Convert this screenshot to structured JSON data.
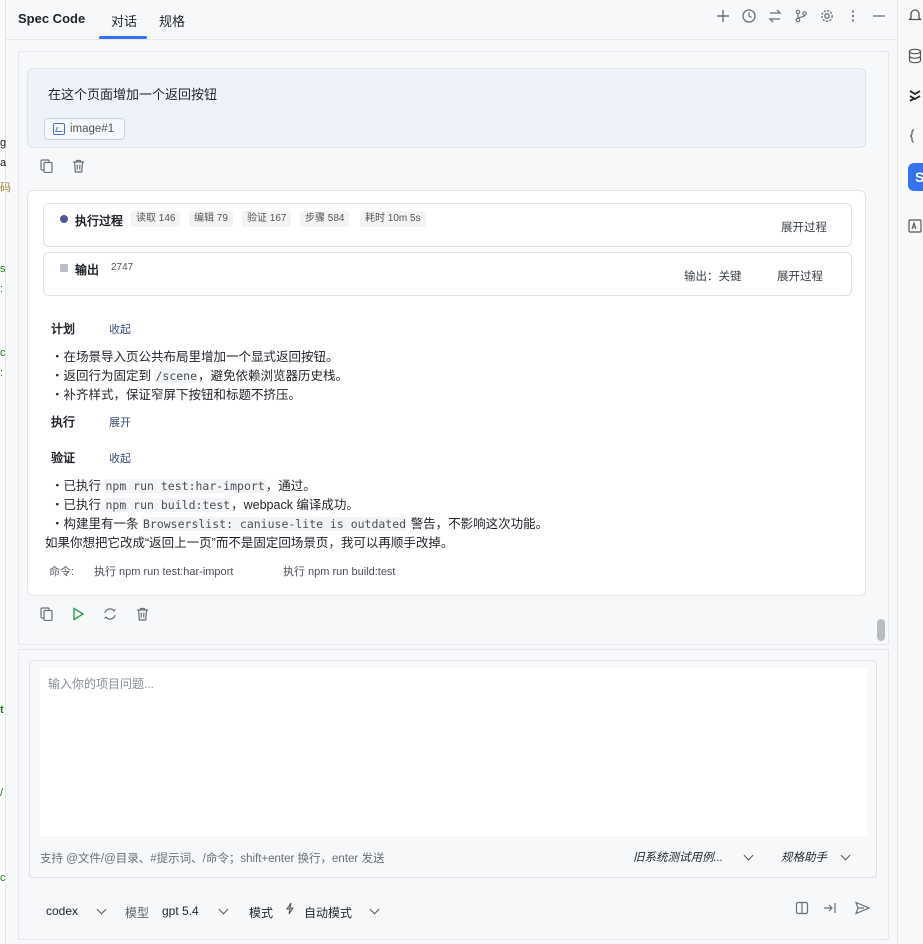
{
  "header": {
    "app_title": "Spec Code",
    "tabs": [
      {
        "label": "对话"
      },
      {
        "label": "规格"
      }
    ]
  },
  "left_strip_fragments": [
    "g",
    "a",
    "码",
    "s",
    ":",
    "c",
    ":",
    "t",
    "/",
    "c"
  ],
  "user_message": {
    "text": "在这个页面增加一个返回按钮",
    "attachment": "image#1"
  },
  "process_bar": {
    "title": "执行过程",
    "stats": [
      "读取 146",
      "编辑 79",
      "验证 167",
      "步骤 584",
      "耗时 10m 5s"
    ],
    "expand": "展开过程"
  },
  "output_bar": {
    "title": "输出",
    "count": "2747",
    "mode": "输出：关键",
    "expand": "展开过程"
  },
  "plan": {
    "title": "计划",
    "toggle": "收起",
    "items": [
      {
        "before": "・在场景导入页公共布局里增加一个显式返回按钮。",
        "code": "",
        "after": ""
      },
      {
        "before": "・返回行为固定到 ",
        "code": "/scene",
        "after": "，避免依赖浏览器历史栈。"
      },
      {
        "before": "・补齐样式，保证窄屏下按钮和标题不挤压。",
        "code": "",
        "after": ""
      }
    ]
  },
  "execute": {
    "title": "执行",
    "toggle": "展开"
  },
  "verify": {
    "title": "验证",
    "toggle": "收起",
    "items": [
      {
        "before": "・已执行 ",
        "code": "npm run test:har-import",
        "after": "，通过。"
      },
      {
        "before": "・已执行 ",
        "code": "npm run build:test",
        "after": "，webpack 编译成功。"
      },
      {
        "before": "・构建里有一条 ",
        "code": "Browserslist: caniuse-lite is outdated",
        "after": " 警告，不影响这次功能。"
      }
    ]
  },
  "closing_text": "如果你想把它改成“返回上一页”而不是固定回场景页，我可以再顺手改掉。",
  "commands": {
    "label": "命令:",
    "items": [
      "执行 npm run test:har-import",
      "执行 npm run build:test"
    ]
  },
  "input": {
    "placeholder": "输入你的项目问题...",
    "value": "",
    "hint": "支持 @文件/@目录、#提示词、/命令；shift+enter 换行，enter 发送",
    "test_select": "旧系统测试用例...",
    "assistant_select": "规格助手"
  },
  "footer": {
    "agent": "codex",
    "model_label": "模型",
    "model": "gpt 5.4",
    "mode_label": "模式",
    "mode": "自动模式"
  },
  "icons": [
    "plus-icon",
    "history-icon",
    "swap-icon",
    "branch-icon",
    "gear-icon",
    "more-icon",
    "minimize-icon",
    "copy-icon",
    "trash-icon",
    "play-icon",
    "refresh-icon",
    "split-icon",
    "insert-icon",
    "send-icon",
    "bell-icon",
    "database-icon"
  ]
}
